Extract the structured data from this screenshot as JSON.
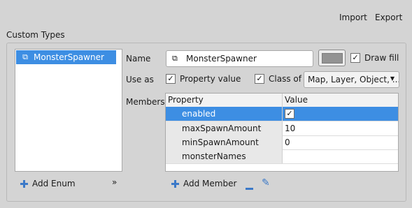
{
  "toolbar": {
    "import_label": "Import",
    "export_label": "Export"
  },
  "group": {
    "title": "Custom Types"
  },
  "type_list": {
    "items": [
      {
        "label": "MonsterSpawner",
        "selected": true
      }
    ]
  },
  "bottom_left": {
    "add_enum_label": "Add Enum",
    "more_glyph": "»"
  },
  "form": {
    "name_label": "Name",
    "name_value": "MonsterSpawner",
    "color_value": "#939393",
    "draw_fill_label": "Draw fill",
    "draw_fill_checked": true,
    "use_as_label": "Use as",
    "property_value_label": "Property value",
    "property_value_checked": true,
    "class_of_label": "Class of",
    "class_of_checked": true,
    "class_of_value": "Map, Layer, Object, ...",
    "members_label": "Members"
  },
  "members_table": {
    "headers": {
      "property": "Property",
      "value": "Value"
    },
    "rows": [
      {
        "property": "enabled",
        "value": "",
        "checkbox": true,
        "selected": true
      },
      {
        "property": "maxSpawnAmount",
        "value": "10"
      },
      {
        "property": "minSpawnAmount",
        "value": "0"
      },
      {
        "property": "monsterNames",
        "value": ""
      }
    ]
  },
  "member_actions": {
    "add_member_label": "Add Member"
  },
  "icons": {
    "class_icon": "class-icon",
    "add": "plus-icon",
    "remove": "minus-icon",
    "rename": "pencil-icon",
    "more": "chevron-double-right-icon"
  },
  "colors": {
    "selection": "#3d8ee3",
    "icon_blue": "#3b79c8",
    "background": "#d4d4d4"
  }
}
